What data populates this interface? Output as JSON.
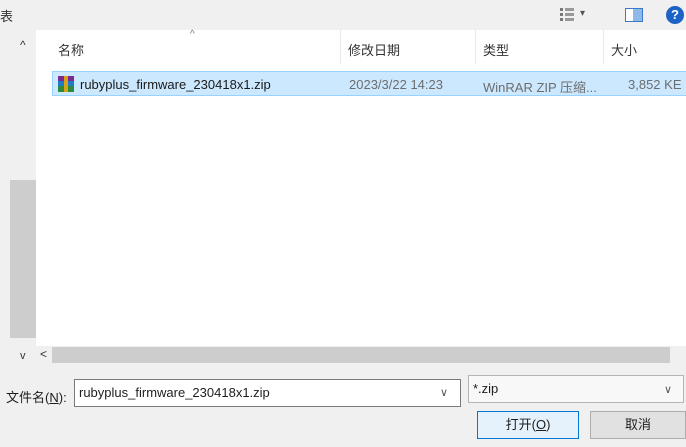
{
  "toolbar": {
    "clipped_title": "表",
    "view_dropdown": "▾",
    "help_glyph": "?"
  },
  "columns": {
    "name": "名称",
    "date": "修改日期",
    "type": "类型",
    "size": "大小",
    "sort_indicator": "^"
  },
  "files": [
    {
      "name": "rubyplus_firmware_230418x1.zip",
      "modified": "2023/3/22 14:23",
      "type": "WinRAR ZIP 压缩...",
      "size": "3,852 KE",
      "icon": "winrar-archive-icon",
      "selected": true
    }
  ],
  "scrollbars": {
    "up": "^",
    "down": "v",
    "left": "<"
  },
  "bottom": {
    "filename_label_prefix": "文件名(",
    "filename_label_accel": "N",
    "filename_label_suffix": "):",
    "filename_value": "rubyplus_firmware_230418x1.zip",
    "filter_value": "*.zip",
    "open_label_prefix": "打开(",
    "open_label_accel": "O",
    "open_label_suffix": ")",
    "cancel_label": "取消"
  },
  "colors": {
    "selection_bg": "#cce8ff",
    "selection_border": "#99d1ff",
    "primary_button_border": "#0078d7",
    "help_icon": "#1d63c5"
  }
}
